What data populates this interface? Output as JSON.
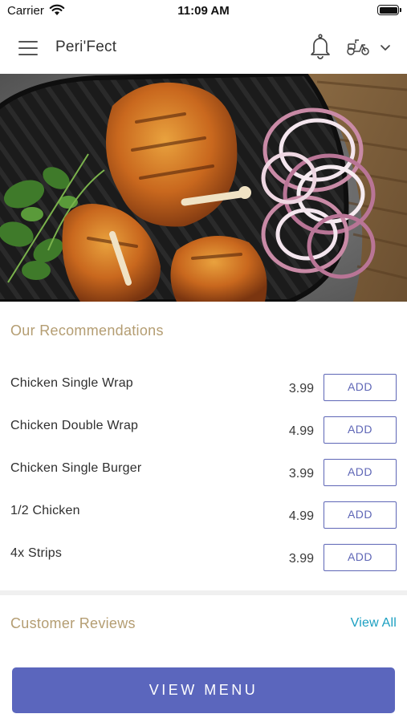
{
  "status_bar": {
    "carrier": "Carrier",
    "time": "11:09 AM",
    "wifi_icon": "wifi-icon",
    "battery_icon": "battery-icon"
  },
  "nav": {
    "title": "Peri'Fect",
    "menu_icon": "hamburger-menu-icon",
    "notification_icon": "bell-icon",
    "delivery_icon": "scooter-icon",
    "dropdown_icon": "chevron-down-icon"
  },
  "hero": {
    "image": "grilled peri-peri chicken with onion rings and coriander on a black grill plate"
  },
  "recommendations": {
    "title": "Our Recommendations",
    "add_label": "ADD",
    "items": [
      {
        "name": "Chicken Single Wrap",
        "price": "3.99"
      },
      {
        "name": "Chicken Double Wrap",
        "price": "4.99"
      },
      {
        "name": "Chicken Single Burger",
        "price": "3.99"
      },
      {
        "name": "1/2 Chicken",
        "price": "4.99"
      },
      {
        "name": "4x Strips",
        "price": "3.99"
      }
    ]
  },
  "reviews": {
    "title": "Customer Reviews",
    "view_all": "View All"
  },
  "cta": {
    "label": "VIEW MENU"
  },
  "colors": {
    "accent": "#5b66bd",
    "section_title": "#b49d72",
    "link": "#1a9fc1"
  }
}
